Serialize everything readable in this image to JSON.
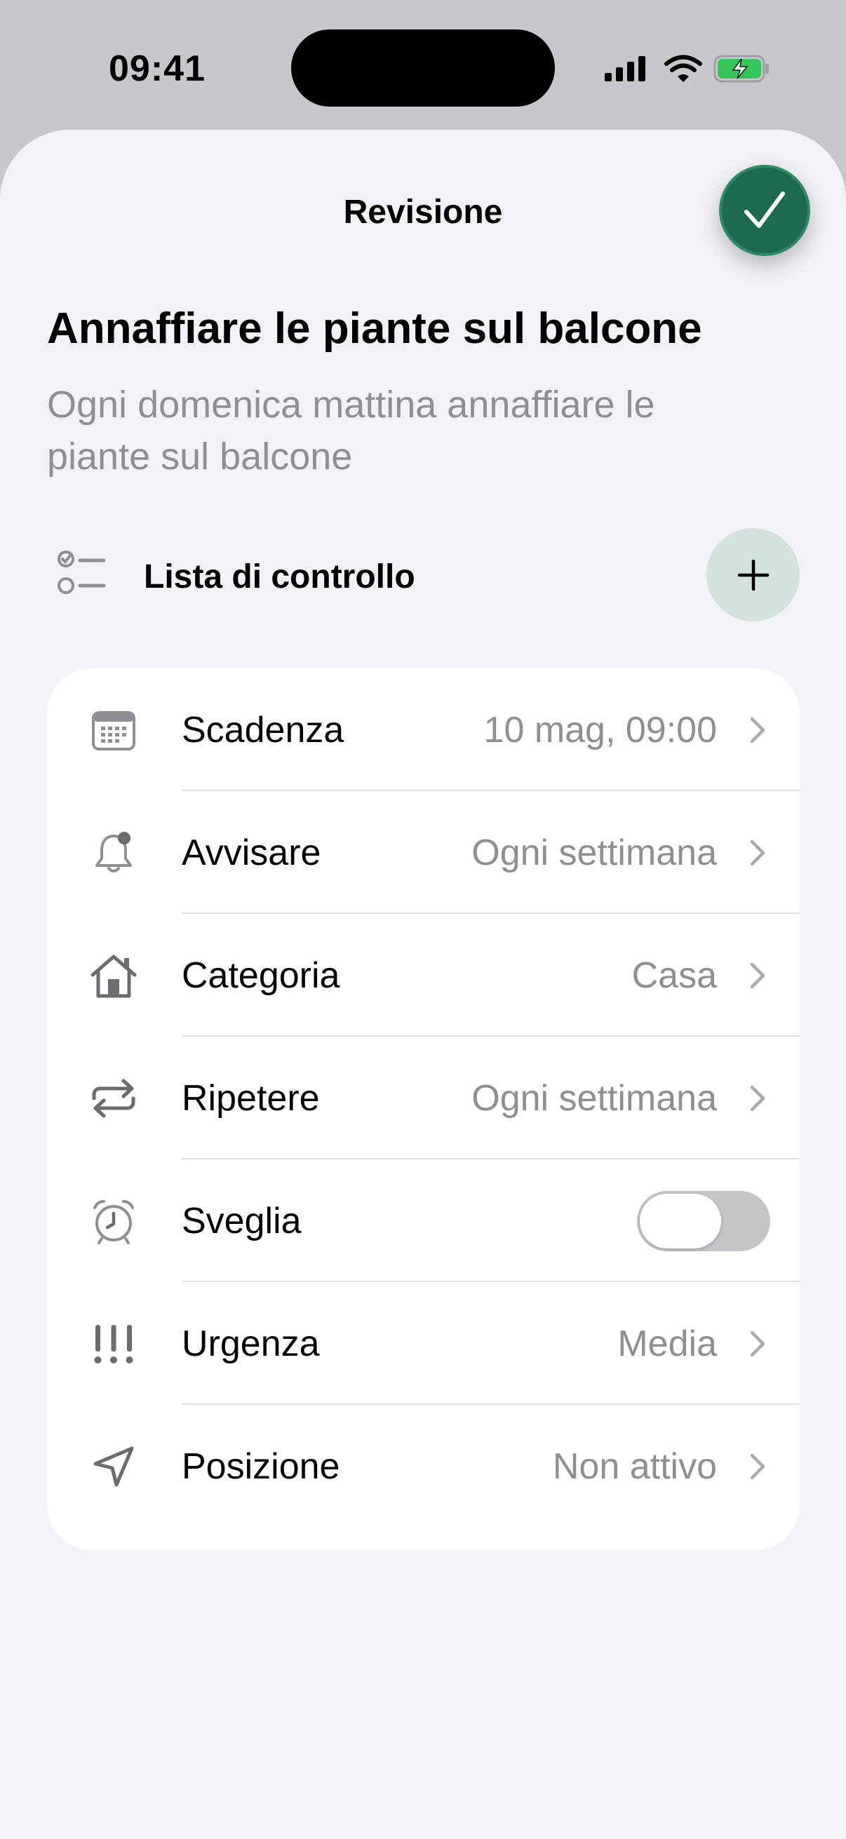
{
  "status_bar": {
    "time": "09:41",
    "icons": [
      "signal-icon",
      "wifi-icon",
      "battery-charging-icon"
    ],
    "battery_color": "#34c759"
  },
  "sheet": {
    "title": "Revisione",
    "confirm_icon": "checkmark-icon",
    "accent_color": "#1d6b4e"
  },
  "task": {
    "title": "Annaffiare le piante sul balcone",
    "description": "Ogni domenica mattina annaffiare le piante sul balcone"
  },
  "checklist": {
    "label": "Lista di controllo",
    "icon": "checklist-icon",
    "add_icon": "plus-icon"
  },
  "settings": [
    {
      "id": "scadenza",
      "icon": "calendar-icon",
      "label": "Scadenza",
      "value": "10 mag, 09:00",
      "type": "disclosure"
    },
    {
      "id": "avvisare",
      "icon": "bell-icon",
      "label": "Avvisare",
      "value": "Ogni settimana",
      "type": "disclosure"
    },
    {
      "id": "categoria",
      "icon": "house-icon",
      "label": "Categoria",
      "value": "Casa",
      "type": "disclosure"
    },
    {
      "id": "ripetere",
      "icon": "repeat-icon",
      "label": "Ripetere",
      "value": "Ogni settimana",
      "type": "disclosure"
    },
    {
      "id": "sveglia",
      "icon": "alarm-clock-icon",
      "label": "Sveglia",
      "value": "",
      "type": "toggle",
      "toggle_on": false
    },
    {
      "id": "urgenza",
      "icon": "exclamation-icon",
      "label": "Urgenza",
      "value": "Media",
      "type": "disclosure"
    },
    {
      "id": "posizione",
      "icon": "location-arrow-icon",
      "label": "Posizione",
      "value": "Non attivo",
      "type": "disclosure"
    }
  ]
}
